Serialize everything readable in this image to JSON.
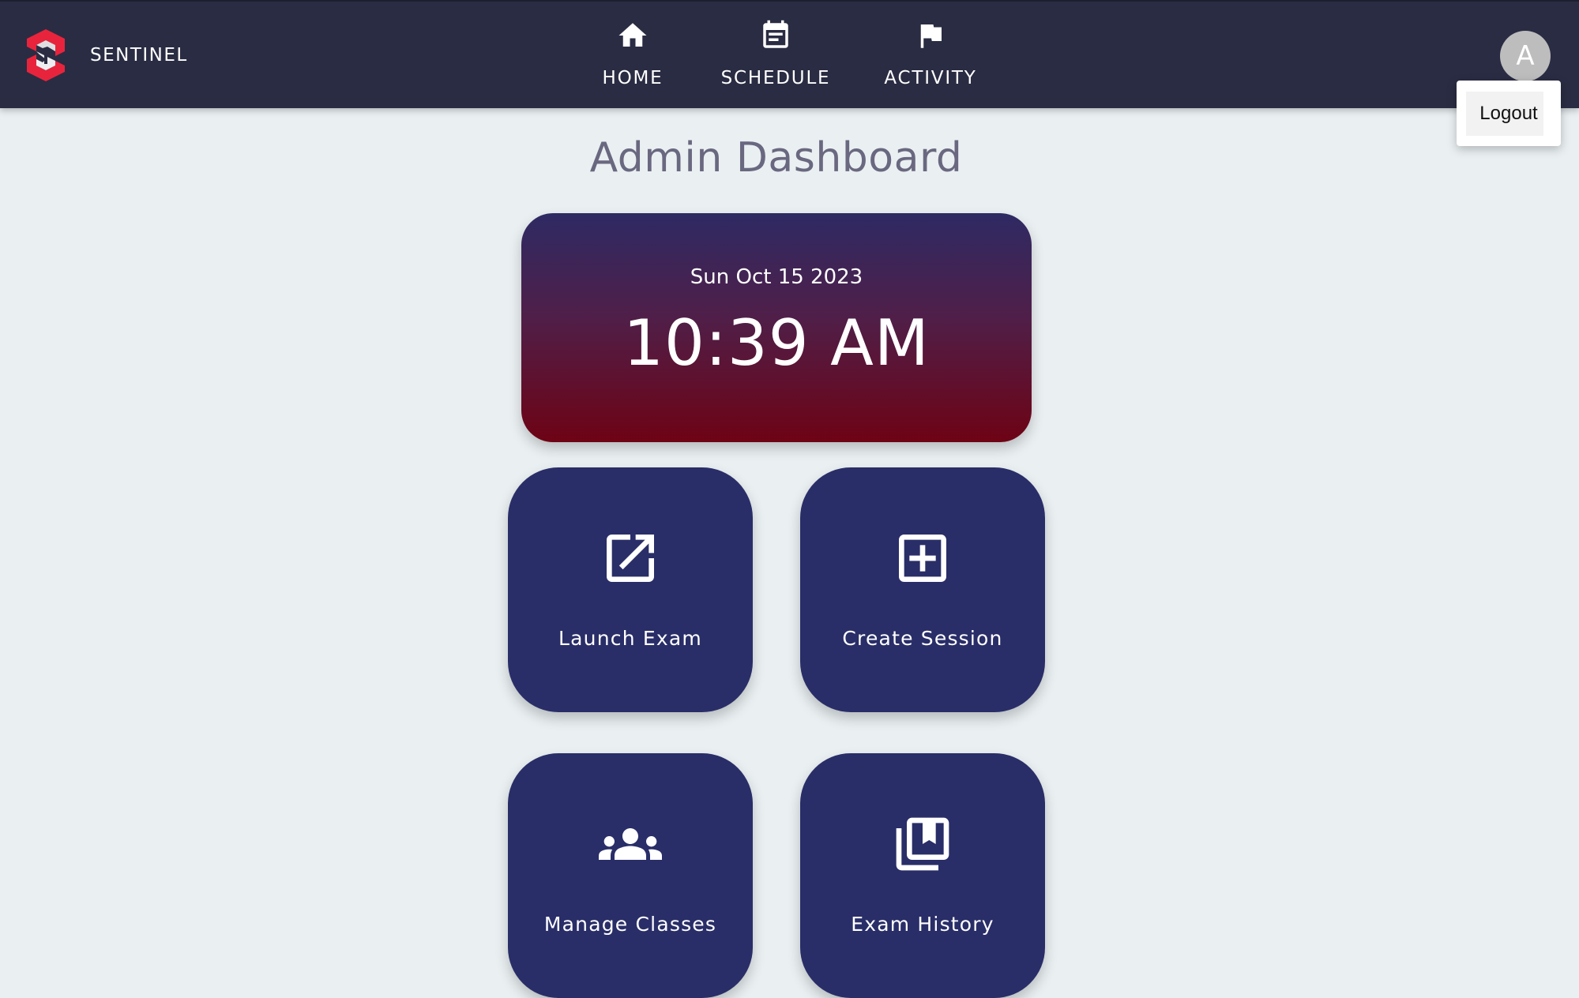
{
  "brand": {
    "name": "SENTINEL",
    "logo_icon": "sentinel-s-logo",
    "logo_colors": [
      "#e8243c",
      "#ffffff"
    ]
  },
  "nav": {
    "items": [
      {
        "label": "HOME",
        "icon": "home-icon"
      },
      {
        "label": "SCHEDULE",
        "icon": "calendar-icon"
      },
      {
        "label": "ACTIVITY",
        "icon": "flag-icon"
      }
    ]
  },
  "user": {
    "avatar_letter": "A",
    "menu": {
      "logout_label": "Logout"
    }
  },
  "page": {
    "title": "Admin Dashboard"
  },
  "clock": {
    "date": "Sun Oct 15 2023",
    "time": "10:39 AM"
  },
  "tiles": [
    {
      "label": "Launch Exam",
      "icon": "open-in-new-icon"
    },
    {
      "label": "Create Session",
      "icon": "add-box-icon"
    },
    {
      "label": "Manage Classes",
      "icon": "groups-icon"
    },
    {
      "label": "Exam History",
      "icon": "library-books-icon"
    }
  ],
  "colors": {
    "navbar": "#2a2c43",
    "background": "#eaf0f2",
    "tile": "#292e68",
    "clock_gradient_top": "#2e2a63",
    "clock_gradient_bottom": "#6e0315",
    "title_text": "#6a6880"
  }
}
